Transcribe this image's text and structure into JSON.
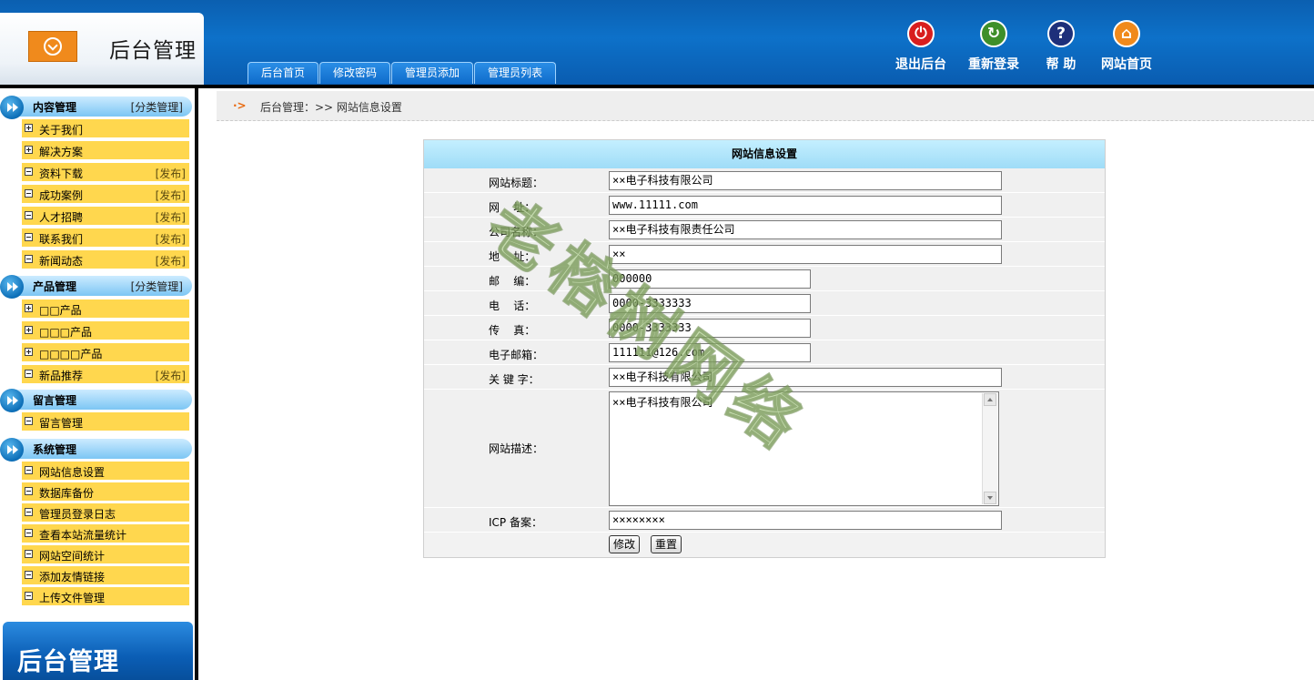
{
  "header": {
    "app_title": "后台管理",
    "nav_tabs": [
      "后台首页",
      "修改密码",
      "管理员添加",
      "管理员列表"
    ],
    "tools": [
      {
        "label": "退出后台",
        "icon": "power-icon",
        "color": "#d81e1e"
      },
      {
        "label": "重新登录",
        "icon": "refresh-icon",
        "color": "#3e8f2a"
      },
      {
        "label": "帮 助",
        "icon": "help-icon",
        "color": "#1d2f7a"
      },
      {
        "label": "网站首页",
        "icon": "home-icon",
        "color": "#f08a1c"
      }
    ]
  },
  "sidebar": {
    "sections": [
      {
        "title": "内容管理",
        "extra": "[分类管理]",
        "items": [
          {
            "label": "关于我们",
            "publish": "",
            "expand": true
          },
          {
            "label": "解决方案",
            "publish": "",
            "expand": true
          },
          {
            "label": "资料下载",
            "publish": "[发布]",
            "expand": false
          },
          {
            "label": "成功案例",
            "publish": "[发布]",
            "expand": false
          },
          {
            "label": "人才招聘",
            "publish": "[发布]",
            "expand": false
          },
          {
            "label": "联系我们",
            "publish": "[发布]",
            "expand": false
          },
          {
            "label": "新闻动态",
            "publish": "[发布]",
            "expand": false
          }
        ]
      },
      {
        "title": "产品管理",
        "extra": "[分类管理]",
        "items": [
          {
            "label": "□□产品",
            "publish": "",
            "expand": true
          },
          {
            "label": "□□□产品",
            "publish": "",
            "expand": true
          },
          {
            "label": "□□□□产品",
            "publish": "",
            "expand": true
          },
          {
            "label": "新品推荐",
            "publish": "[发布]",
            "expand": false
          }
        ]
      },
      {
        "title": "留言管理",
        "extra": "",
        "items": [
          {
            "label": "留言管理",
            "publish": "",
            "expand": false
          }
        ]
      },
      {
        "title": "系统管理",
        "extra": "",
        "items": [
          {
            "label": "网站信息设置",
            "publish": "",
            "expand": false
          },
          {
            "label": "数据库备份",
            "publish": "",
            "expand": false
          },
          {
            "label": "管理员登录日志",
            "publish": "",
            "expand": false
          },
          {
            "label": "查看本站流量统计",
            "publish": "",
            "expand": false
          },
          {
            "label": "网站空间统计",
            "publish": "",
            "expand": false
          },
          {
            "label": "添加友情链接",
            "publish": "",
            "expand": false
          },
          {
            "label": "上传文件管理",
            "publish": "",
            "expand": false
          }
        ]
      }
    ],
    "promo": "后台管理"
  },
  "breadcrumb": {
    "text": "后台管理：>> 网站信息设置"
  },
  "form": {
    "title": "网站信息设置",
    "fields": [
      {
        "label": "网站标题：",
        "value": "××电子科技有限公司"
      },
      {
        "label": "网    址：",
        "value": "www.11111.com"
      },
      {
        "label": "公司名称：",
        "value": "××电子科技有限责任公司"
      },
      {
        "label": "地    址：",
        "value": "××"
      },
      {
        "label": "邮    编：",
        "value": "000000"
      },
      {
        "label": "电    话：",
        "value": "0000-3333333"
      },
      {
        "label": "传    真：",
        "value": "0000-3333333"
      },
      {
        "label": "电子邮箱：",
        "value": "111111@126.com"
      },
      {
        "label": "关 键 字：",
        "value": "××电子科技有限公司"
      }
    ],
    "description": {
      "label": "网站描述：",
      "value": "××电子科技有限公司"
    },
    "icp": {
      "label": "ICP 备案：",
      "value": "××××××××"
    },
    "submit_label": "修改",
    "reset_label": "重置"
  },
  "watermark": "老榕树网络"
}
